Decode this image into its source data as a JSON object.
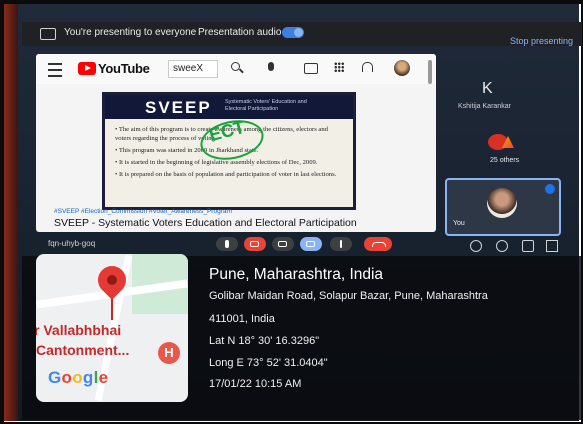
{
  "meet": {
    "presenting_text": "You're presenting to everyone",
    "audio_label": "Presentation audio",
    "stop_label": "Stop presenting",
    "meeting_code": "fqn-uhyb-goq"
  },
  "youtube": {
    "brand": "YouTube",
    "search_value": "sweeX",
    "slide": {
      "title": "SVEEP",
      "subtitle": "Systematic Voters' Education and Electoral Participation",
      "handwriting": "ECT",
      "bullets": [
        "The aim of this program is to create awareness among the citizens, electors and voters regarding the process of voting.",
        "This program was started in 2009 in Jharkhand state.",
        "It is started in the beginning of legislative assembly elections of Dec, 2009.",
        "It is prepared on the basis of population and participation of voter in last elections."
      ]
    },
    "hashtags": "#SVEEP #Election_Commission #Voter_Awareness_Program",
    "video_title": "SVEEP - Systematic Voters Education and Electoral Participation"
  },
  "participants": {
    "avatar_initial": "K",
    "name": "Kshitija Karankar",
    "others": "25 others",
    "self_label": "You"
  },
  "geotag": {
    "city": "Pune, Maharashtra, India",
    "address_line1": "Golibar Maidan Road, Solapur Bazar, Pune, Maharashtra",
    "address_line2": "411001, India",
    "lat": "Lat N 18° 30' 16.3296\"",
    "long": "Long E 73° 52' 31.0404\"",
    "datetime": "17/01/22 10:15 AM",
    "map_label1": "r Vallabhbhai",
    "map_label2": "Cantonment...",
    "map_marker": "H",
    "map_brand_letters": [
      "G",
      "o",
      "o",
      "g",
      "l",
      "e"
    ]
  },
  "colors": {
    "accent_blue": "#8ab4f8",
    "end_call_red": "#ea4335",
    "youtube_red": "#ff0000",
    "ect_green": "#18a43b"
  },
  "icons": [
    "present-icon",
    "menu-icon",
    "youtube-logo-icon",
    "search-icon",
    "mic-icon",
    "create-icon",
    "apps-icon",
    "bell-icon",
    "more-icon",
    "captions-icon",
    "present-now-icon",
    "end-call-icon",
    "info-icon",
    "people-icon",
    "chat-icon",
    "activities-icon",
    "map-pin-icon",
    "hospital-icon"
  ]
}
